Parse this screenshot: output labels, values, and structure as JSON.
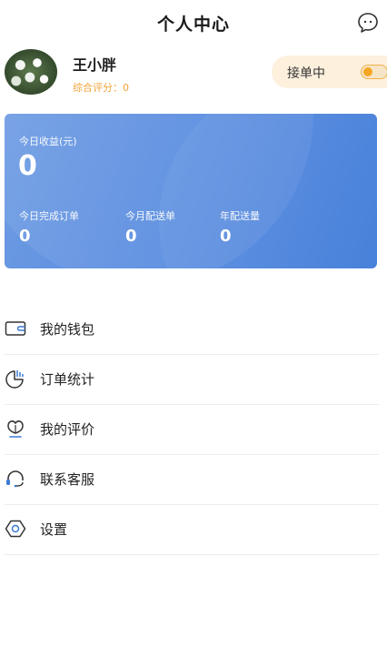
{
  "header": {
    "title": "个人中心"
  },
  "profile": {
    "name": "王小胖",
    "rating_label": "综合评分：",
    "rating_value": "0",
    "status_label": "接单中",
    "status_on": true
  },
  "stats": {
    "today_income_label": "今日收益(元)",
    "today_income_value": "0",
    "items": [
      {
        "label": "今日完成订单",
        "value": "0"
      },
      {
        "label": "今月配送单",
        "value": "0"
      },
      {
        "label": "年配送量",
        "value": "0"
      }
    ]
  },
  "menu": {
    "items": [
      {
        "label": "我的钱包",
        "icon": "wallet-icon"
      },
      {
        "label": "订单统计",
        "icon": "statistics-icon"
      },
      {
        "label": "我的评价",
        "icon": "review-icon"
      },
      {
        "label": "联系客服",
        "icon": "headset-icon"
      },
      {
        "label": "设置",
        "icon": "settings-icon"
      }
    ]
  },
  "colors": {
    "accent_blue": "#4a85dd",
    "accent_orange": "#f5a623",
    "toggle_bg": "#fdf0dd"
  }
}
